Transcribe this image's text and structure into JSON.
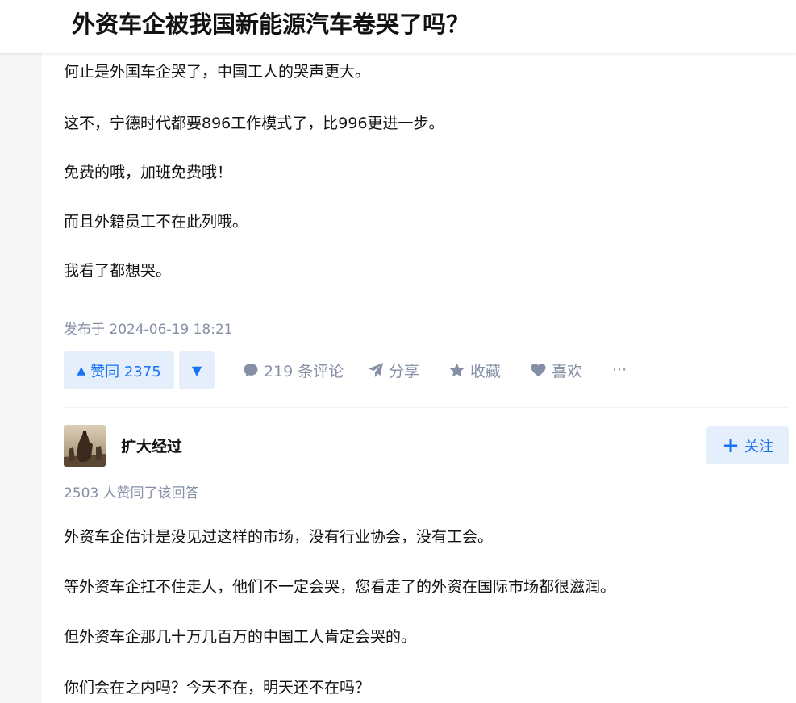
{
  "question": {
    "title": "外资车企被我国新能源汽车卷哭了吗？"
  },
  "answer1": {
    "paragraphs": [
      "何止是外国车企哭了，中国工人的哭声更大。",
      "这不，宁德时代都要896工作模式了，比996更进一步。",
      "免费的哦，加班免费哦！",
      "而且外籍员工不在此列哦。",
      "我看了都想哭。"
    ],
    "published": "发布于 2024-06-19 18:21",
    "actions": {
      "vote_up_label": "赞同 2375",
      "vote_up_arrow": "▲",
      "vote_down_arrow": "▼",
      "comments": "219 条评论",
      "share": "分享",
      "favorite": "收藏",
      "like": "喜欢",
      "more": "···"
    }
  },
  "answer2": {
    "author": "扩大经过",
    "follow_label": "关注",
    "follow_plus": "+",
    "upvote_summary": "2503 人赞同了该回答",
    "paragraphs": [
      "外资车企估计是没见过这样的市场，没有行业协会，没有工会。",
      "等外资车企扛不住走人，他们不一定会哭，您看走了的外资在国际市场都很滋润。",
      "但外资车企那几十万几百万的中国工人肯定会哭的。",
      "你们会在之内吗？今天不在，明天还不在吗？"
    ]
  },
  "colors": {
    "accent": "#1772f6",
    "accent_bg": "#e5eefb",
    "meta": "#8590a6",
    "text": "#121212"
  }
}
